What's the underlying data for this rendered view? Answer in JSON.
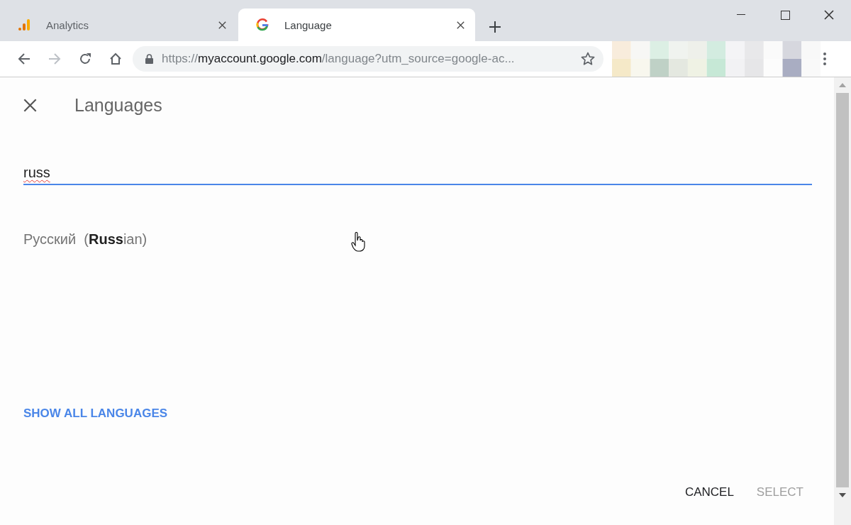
{
  "tabs": [
    {
      "label": "Analytics",
      "selected": false,
      "kind": "bars"
    },
    {
      "label": "Language",
      "selected": true,
      "kind": "g"
    }
  ],
  "toolbar": {
    "buttons": [
      {
        "kind": "back",
        "disabled": false
      },
      {
        "kind": "forward",
        "disabled": true
      },
      {
        "kind": "reload",
        "disabled": false
      },
      {
        "kind": "home",
        "disabled": false
      }
    ],
    "address": {
      "scheme": "https://",
      "host": "myaccount.google.com",
      "path": "/language?utm_source=google-ac..."
    }
  },
  "dialog": {
    "title": "Languages",
    "search": {
      "value": "russ",
      "misspelled": true
    },
    "results": [
      {
        "text": "Русский  (**Russ**ian)"
      }
    ],
    "link": "SHOW ALL LANGUAGES",
    "actions": [
      {
        "label": "CANCEL",
        "disabled": false
      },
      {
        "label": "SELECT",
        "disabled": true
      }
    ]
  }
}
